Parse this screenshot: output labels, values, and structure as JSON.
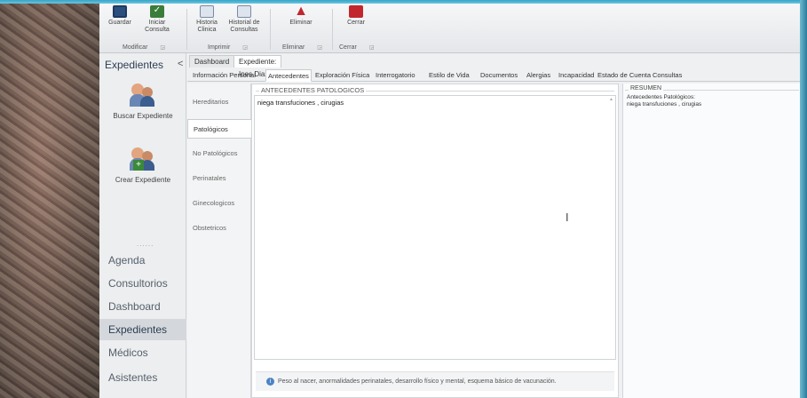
{
  "ribbon": {
    "groups": [
      {
        "name": "Modificar",
        "buttons": [
          {
            "label": "Guardar",
            "icon": "save-icon"
          },
          {
            "label": "Iniciar Consulta",
            "icon": "check-icon"
          }
        ]
      },
      {
        "name": "Imprimir",
        "buttons": [
          {
            "label": "Historia Clinica",
            "icon": "history-icon"
          },
          {
            "label": "Historial de Consultas",
            "icon": "history-icon"
          }
        ]
      },
      {
        "name": "Eliminar",
        "buttons": [
          {
            "label": "Eliminar",
            "icon": "delete-icon"
          }
        ]
      },
      {
        "name": "Cerrar",
        "buttons": [
          {
            "label": "Cerrar",
            "icon": "close-icon"
          }
        ]
      }
    ]
  },
  "leftnav": {
    "header": "Expedientes",
    "collapse_glyph": "<",
    "tools": [
      {
        "label": "Buscar Expediente",
        "icon": "search-patient-icon"
      },
      {
        "label": "Crear Expediente",
        "icon": "create-patient-icon"
      }
    ],
    "dots": "......",
    "items": [
      "Agenda",
      "Consultorios",
      "Dashboard",
      "Expedientes",
      "Médicos",
      "Asistentes"
    ],
    "active_item": "Expedientes"
  },
  "doctabs": [
    "Dashboard",
    "Expediente: Ines Diaz Velazquez"
  ],
  "subtabs": [
    "Información Personal",
    "Antecedentes",
    "Exploración Física",
    "Interrogatorio",
    "Estilo de Vida",
    "Documentos",
    "Alergias",
    "Incapacidad",
    "Estado de Cuenta",
    "Consultas"
  ],
  "sidetabs": [
    "Hereditarios",
    "Patológicos",
    "No Patológicos",
    "Perinatales",
    "Ginecologicos",
    "Obstetricos"
  ],
  "editor": {
    "legend": "ANTECEDENTES PATOLOGICOS",
    "value": "niega transfuciones , cirugias",
    "hint": "Peso al nacer, anormalidades perinatales, desarrollo físico y mental, esquema básico de vacunación."
  },
  "resumen": {
    "legend": "RESUMEN",
    "line1": "Antecedentes Patológicos:",
    "line2": "niega transfuciones , cirugias"
  },
  "colors": {
    "accent": "#2d3e50",
    "close_red": "#c1272d"
  }
}
